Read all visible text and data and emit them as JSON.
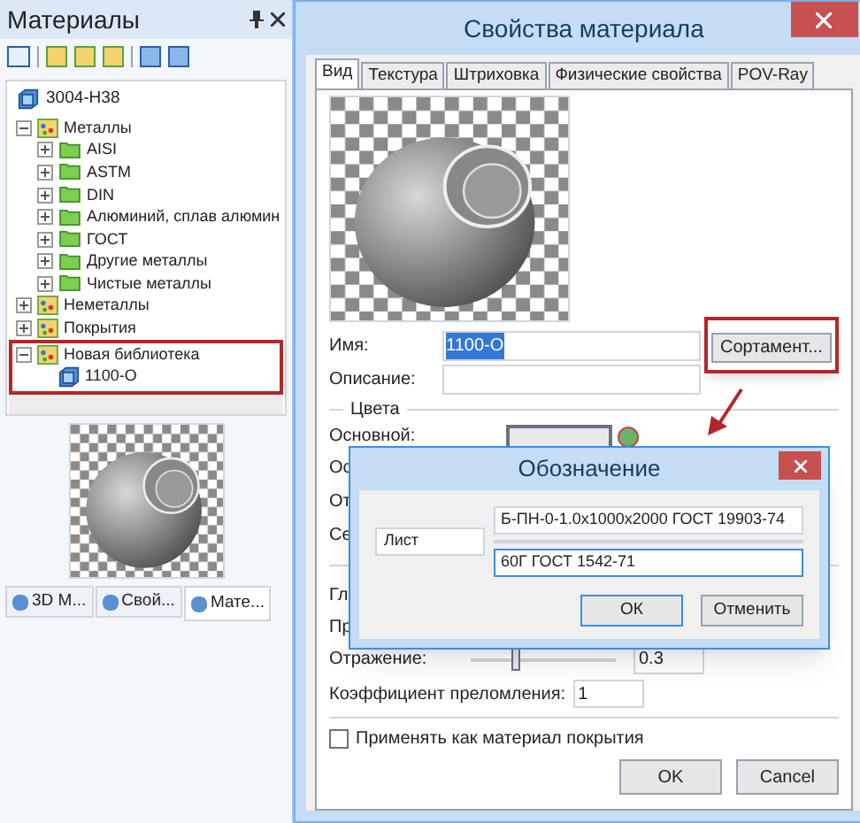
{
  "panel": {
    "title": "Материалы",
    "current": "3004-H38",
    "tree": [
      {
        "label": "Металлы",
        "kind": "library",
        "expanded": true,
        "highlighted": false,
        "children": [
          {
            "label": "AISI",
            "kind": "folder",
            "expanded": false,
            "highlighted": false
          },
          {
            "label": "ASTM",
            "kind": "folder",
            "expanded": false,
            "highlighted": false
          },
          {
            "label": "DIN",
            "kind": "folder",
            "expanded": false,
            "highlighted": false
          },
          {
            "label": "Алюминий, сплав алюмин",
            "kind": "folder",
            "expanded": false,
            "highlighted": false
          },
          {
            "label": "ГОСТ",
            "kind": "folder",
            "expanded": false,
            "highlighted": false
          },
          {
            "label": "Другие металлы",
            "kind": "folder",
            "expanded": false,
            "highlighted": false
          },
          {
            "label": "Чистые металлы",
            "kind": "folder",
            "expanded": false,
            "highlighted": false
          }
        ]
      },
      {
        "label": "Неметаллы",
        "kind": "library",
        "expanded": false,
        "highlighted": false
      },
      {
        "label": "Покрытия",
        "kind": "library",
        "expanded": false,
        "highlighted": false
      },
      {
        "label": "Новая библиотека",
        "kind": "library",
        "expanded": true,
        "highlighted": true,
        "children": [
          {
            "label": "1100-O",
            "kind": "material",
            "highlighted": false
          }
        ]
      }
    ],
    "tabs": [
      {
        "label": "3D M...",
        "selected": false
      },
      {
        "label": "Свой...",
        "selected": false
      },
      {
        "label": "Мате...",
        "selected": true
      }
    ]
  },
  "dialog": {
    "title": "Свойства материала",
    "tabs": [
      {
        "label": "Вид",
        "selected": true
      },
      {
        "label": "Текстура",
        "selected": false
      },
      {
        "label": "Штриховка",
        "selected": false
      },
      {
        "label": "Физические свойства",
        "selected": false
      },
      {
        "label": "POV-Ray",
        "selected": false
      }
    ],
    "name_label": "Имя:",
    "name_value": "1100-O",
    "assortment_button": {
      "label": "Сортамент...",
      "highlighted": true
    },
    "description_label": "Описание:",
    "colors_group": "Цвета",
    "main_color_label": "Основной:",
    "covered_labels": [
      "Ос",
      "От",
      "Се"
    ],
    "covered_labels_2": [
      "Гл",
      "Пр"
    ],
    "reflection": {
      "label": "Отражение:",
      "level": 0.3,
      "value": "0.3"
    },
    "refraction": {
      "label": "Коэффициент преломления:",
      "value": "1"
    },
    "coating_checkbox": {
      "label": "Применять как материал покрытия",
      "checked": false
    },
    "buttons": [
      "OK",
      "Cancel"
    ]
  },
  "designation_dialog": {
    "title": "Обозначение",
    "type_value": "Лист",
    "line_1": "Б-ПН-0-1.0x1000x2000 ГОСТ 19903-74",
    "line_2": "60Г ГОСТ 1542-71",
    "buttons": [
      "ОК",
      "Отменить"
    ]
  }
}
